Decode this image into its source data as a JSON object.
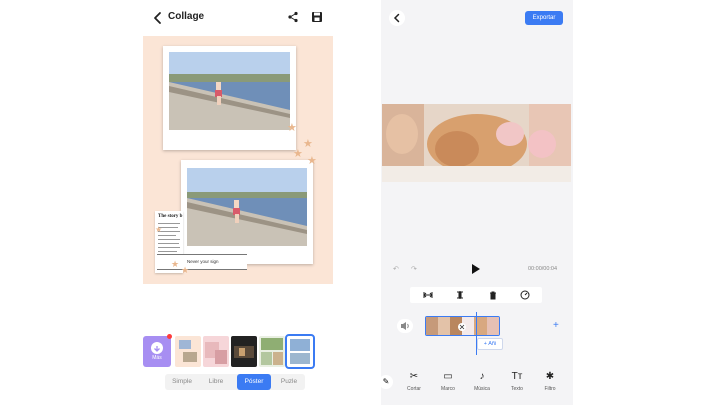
{
  "collage": {
    "title": "Collage",
    "news_headline": "The story b",
    "tape_text": "Never your sign",
    "more_label": "Más",
    "layout_tabs": [
      "Simple",
      "Libre",
      "Póster",
      "Puzle"
    ],
    "active_tab": "Póster"
  },
  "editor": {
    "export_label": "Exportar",
    "timecode": "00:00/00:04",
    "add_label": "+ Añi",
    "tools": [
      {
        "icon": "scissors-icon",
        "label": "Cortar"
      },
      {
        "icon": "frame-icon",
        "label": "Marco"
      },
      {
        "icon": "music-icon",
        "label": "Música"
      },
      {
        "icon": "text-icon",
        "label": "Texto"
      },
      {
        "icon": "sticker-icon",
        "label": "Filtro"
      }
    ]
  },
  "colors": {
    "accent": "#3b7bf3",
    "canvas_bg": "#fbe5d6",
    "more_bg": "#a78ef2"
  }
}
